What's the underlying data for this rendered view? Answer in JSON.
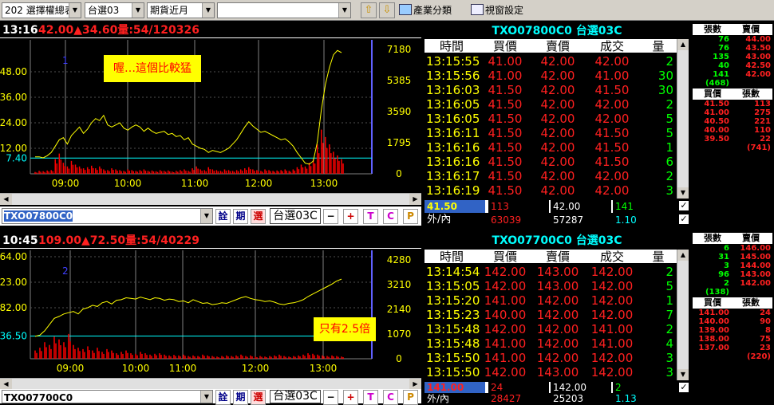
{
  "toolbar": {
    "group_select": "202  選擇權總表",
    "board_select": "台選03",
    "period_select": "期貨近月",
    "blank_select": "",
    "industry_button": "產業分類",
    "view_button": "視窗設定"
  },
  "panels": [
    {
      "header_time": "13:16",
      "header_quote": "42.00▲34.60量:54/120326",
      "chart_data": {
        "type": "line",
        "series": [
          {
            "values": [
              8.0,
              8.0,
              7.5,
              8.5,
              10.0,
              13.0,
              16.0,
              17.0,
              14.0,
              18.0,
              20.0,
              22.0,
              19.0,
              21.0,
              24.0,
              26.0,
              25.0,
              27.5,
              23.0,
              22.0,
              23.0,
              24.0,
              21.5,
              20.5,
              22.0,
              23.0,
              22.0,
              20.0,
              21.5,
              20.0,
              19.0,
              19.5,
              20.0,
              18.5,
              19.0,
              17.5,
              18.0,
              16.0,
              17.0,
              14.0,
              13.0,
              12.0,
              11.5,
              10.0,
              11.0,
              10.5,
              10.0,
              11.0,
              12.0,
              14.0,
              16.0,
              19.0,
              22.0,
              24.5,
              22.5,
              21.0,
              19.5,
              20.0,
              19.0,
              18.0,
              17.0,
              16.0,
              16.5,
              15.0,
              13.0,
              10.0,
              7.5,
              5.0,
              4.5,
              6.0,
              15.0,
              30.0,
              42.0,
              50.0,
              56.0,
              58.0,
              57.0
            ]
          }
        ],
        "volume": [
          5,
          8,
          7,
          9,
          10,
          40,
          55,
          30,
          20,
          35,
          25,
          20,
          15,
          18,
          22,
          15,
          20,
          12,
          10,
          15,
          12,
          10,
          8,
          12,
          10,
          8,
          10,
          12,
          8,
          9,
          7,
          10,
          8,
          9,
          6,
          8,
          10,
          12,
          8,
          15,
          20,
          12,
          10,
          18,
          12,
          10,
          8,
          12,
          10,
          8,
          10,
          12,
          15,
          18,
          12,
          10,
          8,
          12,
          10,
          8,
          9,
          10,
          12,
          8,
          12,
          18,
          25,
          20,
          30,
          40,
          80,
          120,
          100,
          80,
          60,
          50,
          40
        ],
        "y_ticks": [
          "48.00",
          "36.00",
          "24.00",
          "12.00"
        ],
        "ref_value": "7.40",
        "vol_ticks": [
          "7180",
          "5385",
          "3590",
          "1795",
          "0"
        ],
        "x_ticks": [
          "09:00",
          "10:00",
          "11:00",
          "12:00",
          "13:00"
        ],
        "ymax": 60.0,
        "ref": 7.4
      },
      "marker": "1",
      "annotation": "喔…這個比較猛",
      "symbol": "TXO07800C0",
      "group": "台選03C",
      "ticks": {
        "title": "TXO07800C0 台選03C",
        "columns": [
          "時間",
          "買價",
          "賣價",
          "成交",
          "量"
        ],
        "rows": [
          [
            "13:15:55",
            "41.00",
            "42.00",
            "42.00",
            "2"
          ],
          [
            "13:15:56",
            "41.00",
            "42.00",
            "41.00",
            "30"
          ],
          [
            "13:16:03",
            "41.50",
            "42.00",
            "41.50",
            "30"
          ],
          [
            "13:16:05",
            "41.50",
            "42.00",
            "42.00",
            "2"
          ],
          [
            "13:16:05",
            "41.50",
            "42.00",
            "42.00",
            "5"
          ],
          [
            "13:16:11",
            "41.50",
            "42.00",
            "41.50",
            "5"
          ],
          [
            "13:16:16",
            "41.50",
            "42.00",
            "41.50",
            "1"
          ],
          [
            "13:16:16",
            "41.50",
            "42.00",
            "41.50",
            "6"
          ],
          [
            "13:16:17",
            "41.50",
            "42.00",
            "42.00",
            "2"
          ],
          [
            "13:16:19",
            "41.50",
            "42.00",
            "42.00",
            "3"
          ]
        ],
        "summary": [
          "41.50",
          "113",
          "42.00",
          "141"
        ],
        "out_in_label": "外/內",
        "out_in": [
          "63039",
          "57287",
          "1.10"
        ]
      },
      "book": {
        "head_top": [
          "張數",
          "賣價"
        ],
        "asks": [
          [
            "76",
            "44.00"
          ],
          [
            "76",
            "43.50"
          ],
          [
            "135",
            "43.00"
          ],
          [
            "40",
            "42.50"
          ],
          [
            "141",
            "42.00"
          ]
        ],
        "ask_total": "(468)",
        "head_mid": [
          "買價",
          "張數"
        ],
        "bids": [
          [
            "41.50",
            "113"
          ],
          [
            "41.00",
            "275"
          ],
          [
            "40.50",
            "221"
          ],
          [
            "40.00",
            "110"
          ],
          [
            "39.50",
            "22"
          ]
        ],
        "bid_total": "(741)"
      }
    },
    {
      "header_time": "10:45",
      "header_quote": "109.00▲72.50量:54/40229",
      "chart_data": {
        "type": "line",
        "series": [
          {
            "values": [
              36.0,
              38.0,
              45.0,
              55.0,
              65.0,
              68.0,
              72.0,
              74.0,
              76.0,
              72.0,
              80.0,
              82.0,
              86.0,
              84.0,
              90.0,
              92.0,
              88.0,
              94.0,
              95.0,
              98.0,
              97.0,
              96.0,
              99.0,
              97.0,
              95.0,
              98.0,
              97.0,
              94.0,
              96.0,
              95.0,
              92.0,
              93.0,
              90.0,
              95.0,
              92.0,
              89.0,
              90.0,
              87.0,
              88.0,
              90.0,
              89.0,
              92.0,
              95.0,
              98.0,
              100.0,
              97.0,
              95.0,
              94.0,
              92.0,
              93.0,
              91.0,
              88.0,
              87.0,
              89.0,
              90.0,
              92.0,
              95.0,
              100.0,
              104.0,
              108.0,
              112.0,
              116.0,
              120.0,
              125.0,
              128.0
            ]
          }
        ],
        "volume": [
          30,
          40,
          60,
          50,
          80,
          70,
          60,
          90,
          50,
          40,
          35,
          45,
          30,
          40,
          25,
          35,
          30,
          20,
          25,
          30,
          20,
          18,
          25,
          20,
          15,
          18,
          20,
          15,
          12,
          14,
          12,
          15,
          10,
          12,
          10,
          15,
          12,
          10,
          8,
          10,
          12,
          10,
          12,
          15,
          10,
          12,
          8,
          10,
          8,
          10,
          12,
          15,
          10,
          8,
          10,
          12,
          15,
          20,
          18,
          15,
          12,
          10,
          12,
          10,
          8
        ],
        "y_ticks": [
          "164.00",
          "123.00",
          "82.00"
        ],
        "ref_value": "36.50",
        "vol_ticks": [
          "4280",
          "3210",
          "2140",
          "1070",
          "0"
        ],
        "x_ticks": [
          "09:00",
          "10:00",
          "11:00",
          "12:00",
          "13:00"
        ],
        "ymax": 164.0,
        "ref": 36.5
      },
      "marker": "2",
      "annotation": "只有2.5倍",
      "symbol": "TXO07700C0",
      "group": "台選03C",
      "ticks": {
        "title": "TXO07700C0 台選03C",
        "columns": [
          "時間",
          "買價",
          "賣價",
          "成交",
          "量"
        ],
        "rows": [
          [
            "13:14:54",
            "142.00",
            "143.00",
            "142.00",
            "2"
          ],
          [
            "13:15:05",
            "142.00",
            "143.00",
            "142.00",
            "5"
          ],
          [
            "13:15:20",
            "141.00",
            "142.00",
            "142.00",
            "1"
          ],
          [
            "13:15:23",
            "140.00",
            "142.00",
            "142.00",
            "7"
          ],
          [
            "13:15:48",
            "142.00",
            "142.00",
            "141.00",
            "2"
          ],
          [
            "13:15:48",
            "141.00",
            "142.00",
            "141.00",
            "4"
          ],
          [
            "13:15:50",
            "141.00",
            "142.00",
            "142.00",
            "3"
          ],
          [
            "13:15:50",
            "142.00",
            "143.00",
            "142.00",
            "3"
          ]
        ],
        "summary": [
          "141.00",
          "24",
          "142.00",
          "2"
        ],
        "out_in_label": "外/內",
        "out_in": [
          "28427",
          "25203",
          "1.13"
        ]
      },
      "book": {
        "head_top": [
          "張數",
          "賣價"
        ],
        "asks": [
          [
            "6",
            "146.00"
          ],
          [
            "31",
            "145.00"
          ],
          [
            "3",
            "144.00"
          ],
          [
            "96",
            "143.00"
          ],
          [
            "2",
            "142.00"
          ]
        ],
        "ask_total": "(138)",
        "head_mid": [
          "買價",
          "張數"
        ],
        "bids": [
          [
            "141.00",
            "24"
          ],
          [
            "140.00",
            "90"
          ],
          [
            "139.00",
            "8"
          ],
          [
            "138.00",
            "75"
          ],
          [
            "137.00",
            "23"
          ]
        ],
        "bid_total": "(220)"
      }
    }
  ],
  "ctrl_buttons": [
    "詮",
    "期",
    "選",
    "−",
    "+",
    "T",
    "C",
    "P"
  ],
  "colors": {
    "up": "#ff0000",
    "price_line": "#ffff00",
    "volume": "#ff0000",
    "time": "#ffff00",
    "ref": "#00ffff",
    "grid": "#808080",
    "bid": "#ff2020",
    "ask": "#ffff00",
    "qty": "#00ff00"
  }
}
